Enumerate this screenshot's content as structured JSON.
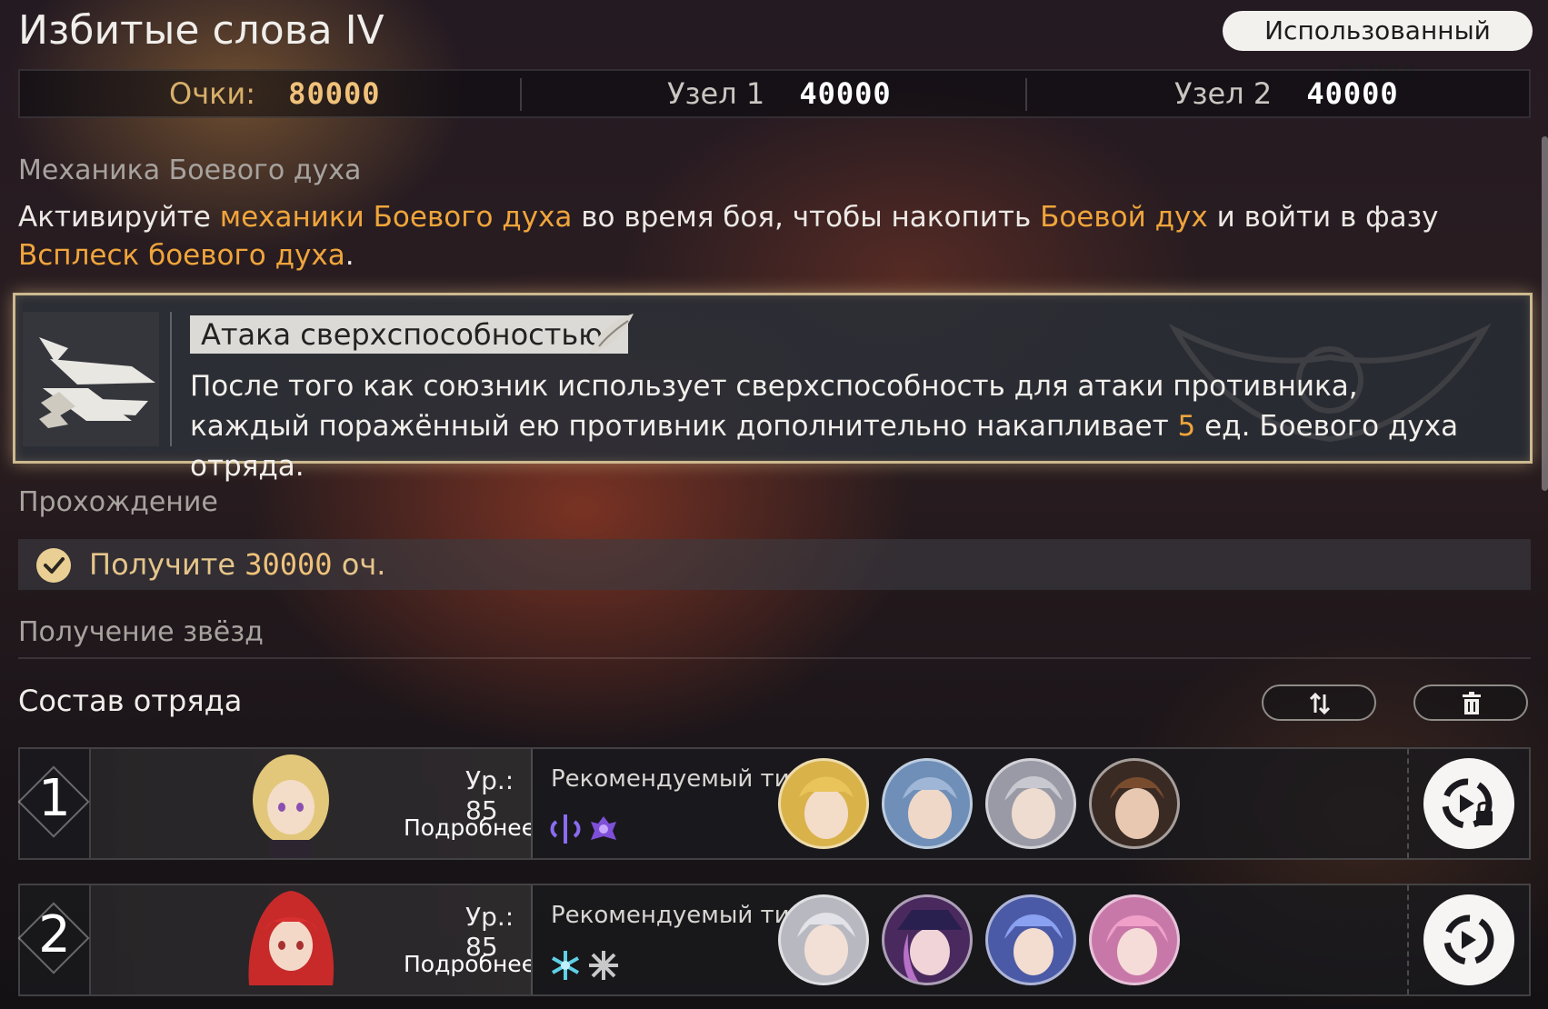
{
  "header": {
    "title": "Избитые слова IV",
    "used_team_button": "Использованный отряд"
  },
  "scores": {
    "total_label": "Очки:",
    "total_value": "80000",
    "node1_label": "Узел 1",
    "node1_value": "40000",
    "node2_label": "Узел 2",
    "node2_value": "40000"
  },
  "mechanic": {
    "section_title": "Механика Боевого духа",
    "text_1": "Активируйте ",
    "link_1": "механики Боевого духа",
    "text_2": " во время боя, чтобы накопить ",
    "link_2": "Боевой дух",
    "text_3": " и войти в фазу ",
    "link_3": "Всплеск боевого духа",
    "text_4": "."
  },
  "buff_card": {
    "tag": "Атака сверхспособностью",
    "desc_1": "После того как союзник использует сверхспособность для атаки противника, каждый поражённый ею противник дополнительно накапливает ",
    "desc_value": "5",
    "desc_2": " ед. Боевого духа отряда."
  },
  "clear": {
    "section_title": "Прохождение",
    "objective_prefix": "Получите ",
    "objective_value": "30000",
    "objective_suffix": " оч."
  },
  "stars": {
    "section_title": "Получение звёзд"
  },
  "squad": {
    "title": "Состав отряда",
    "swap_icon": "swap-arrows-icon",
    "delete_icon": "trash-icon",
    "teams": [
      {
        "number": "1",
        "level_label": "Ур.: 85",
        "details_label": "Подробнее",
        "rec_label": "Рекомендуемый тип",
        "element_icons": [
          "imaginary-icon",
          "quantum-icon"
        ],
        "element_colors": [
          "#8a6cf0",
          "#8a5ae0"
        ],
        "avatar_colors": [
          "#d9b24a",
          "#6f8fb8",
          "#9a9aa6",
          "#7a4c2e"
        ],
        "action_icon": "auto-team-lock-icon"
      },
      {
        "number": "2",
        "level_label": "Ур.: 85",
        "details_label": "Подробнее",
        "rec_label": "Рекомендуемый тип",
        "element_icons": [
          "ice-icon",
          "physical-icon"
        ],
        "element_colors": [
          "#5fd0e6",
          "#c8c8c8"
        ],
        "avatar_colors": [
          "#b8b8c0",
          "#8c4fa6",
          "#6a78d6",
          "#d888b4"
        ],
        "action_icon": "auto-team-icon"
      }
    ]
  }
}
